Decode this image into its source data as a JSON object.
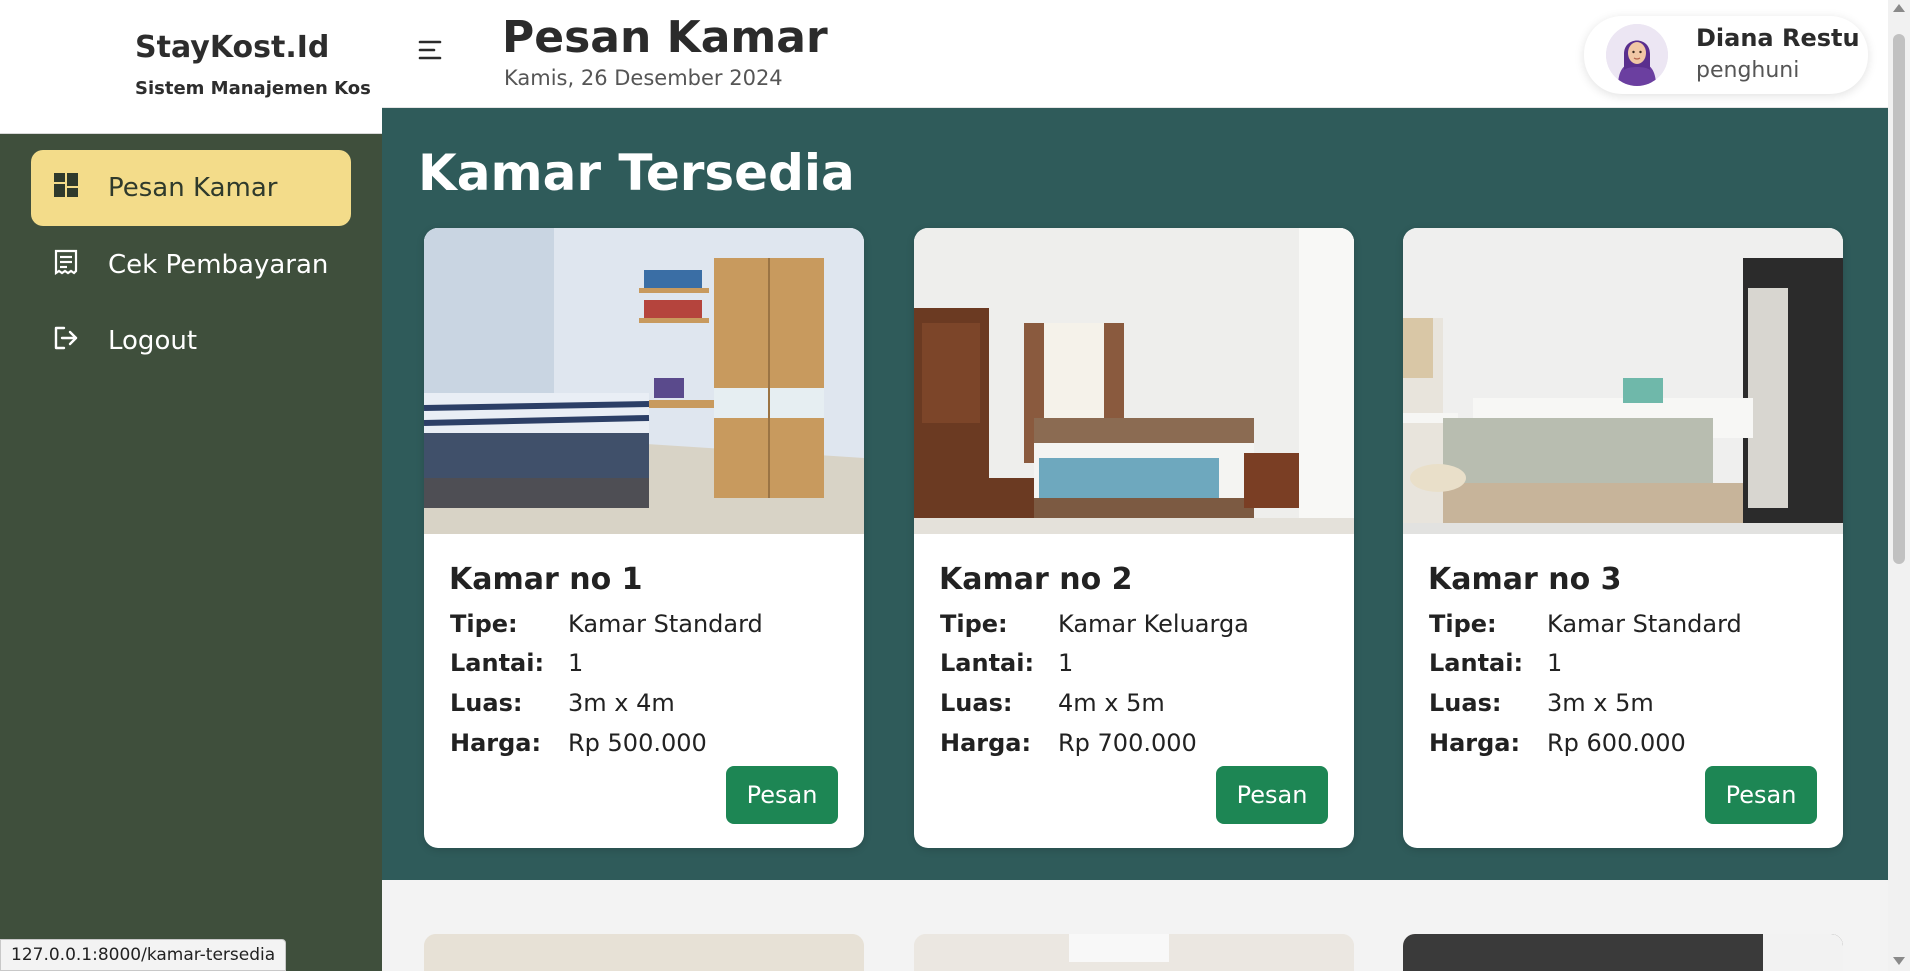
{
  "brand": {
    "title": "StayKost.Id",
    "subtitle": "Sistem Manajemen Kos"
  },
  "sidebar": {
    "items": [
      {
        "label": "Pesan Kamar",
        "icon": "dashboard-icon",
        "active": true
      },
      {
        "label": "Cek Pembayaran",
        "icon": "receipt-icon",
        "active": false
      },
      {
        "label": "Logout",
        "icon": "logout-icon",
        "active": false
      }
    ]
  },
  "header": {
    "title": "Pesan Kamar",
    "date": "Kamis, 26 Desember 2024"
  },
  "user": {
    "name": "Diana Restu",
    "role": "penghuni"
  },
  "main": {
    "section_title": "Kamar Tersedia",
    "rooms": [
      {
        "title": "Kamar no 1",
        "tipe_label": "Tipe:",
        "tipe": "Kamar Standard",
        "lantai_label": "Lantai:",
        "lantai": "1",
        "luas_label": "Luas:",
        "luas": "3m x 4m",
        "harga_label": "Harga:",
        "harga": "Rp 500.000",
        "button": "Pesan"
      },
      {
        "title": "Kamar no 2",
        "tipe_label": "Tipe:",
        "tipe": "Kamar Keluarga",
        "lantai_label": "Lantai:",
        "lantai": "1",
        "luas_label": "Luas:",
        "luas": "4m x 5m",
        "harga_label": "Harga:",
        "harga": "Rp 700.000",
        "button": "Pesan"
      },
      {
        "title": "Kamar no 3",
        "tipe_label": "Tipe:",
        "tipe": "Kamar Standard",
        "lantai_label": "Lantai:",
        "lantai": "1",
        "luas_label": "Luas:",
        "luas": "3m x 5m",
        "harga_label": "Harga:",
        "harga": "Rp 600.000",
        "button": "Pesan"
      }
    ]
  },
  "statusbar": {
    "url": "127.0.0.1:8000/kamar-tersedia"
  },
  "colors": {
    "sidebar_bg": "#3f4f3c",
    "active_item": "#f3dc8a",
    "section_bg": "#2f5b5a",
    "button": "#1d8654"
  }
}
